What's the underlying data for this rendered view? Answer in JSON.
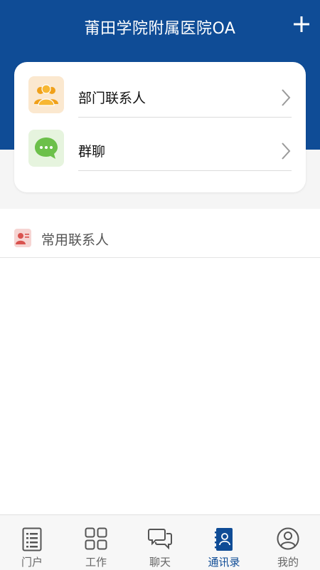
{
  "header": {
    "title": "莆田学院附属医院OA",
    "add_icon": "plus-icon"
  },
  "card": {
    "items": [
      {
        "label": "部门联系人",
        "icon": "department-contacts-icon",
        "icon_color": "#f0a019"
      },
      {
        "label": "群聊",
        "icon": "group-chat-icon",
        "icon_color": "#6cc04a"
      }
    ]
  },
  "frequent": {
    "label": "常用联系人",
    "icon": "frequent-contact-icon",
    "icon_color": "#d9534f"
  },
  "tabs": [
    {
      "label": "门户",
      "icon": "portal-icon",
      "active": false
    },
    {
      "label": "工作",
      "icon": "work-grid-icon",
      "active": false
    },
    {
      "label": "聊天",
      "icon": "chat-bubbles-icon",
      "active": false
    },
    {
      "label": "通讯录",
      "icon": "address-book-icon",
      "active": true
    },
    {
      "label": "我的",
      "icon": "profile-icon",
      "active": false
    }
  ],
  "colors": {
    "brand": "#0f4c96",
    "tab_inactive": "#666666"
  }
}
